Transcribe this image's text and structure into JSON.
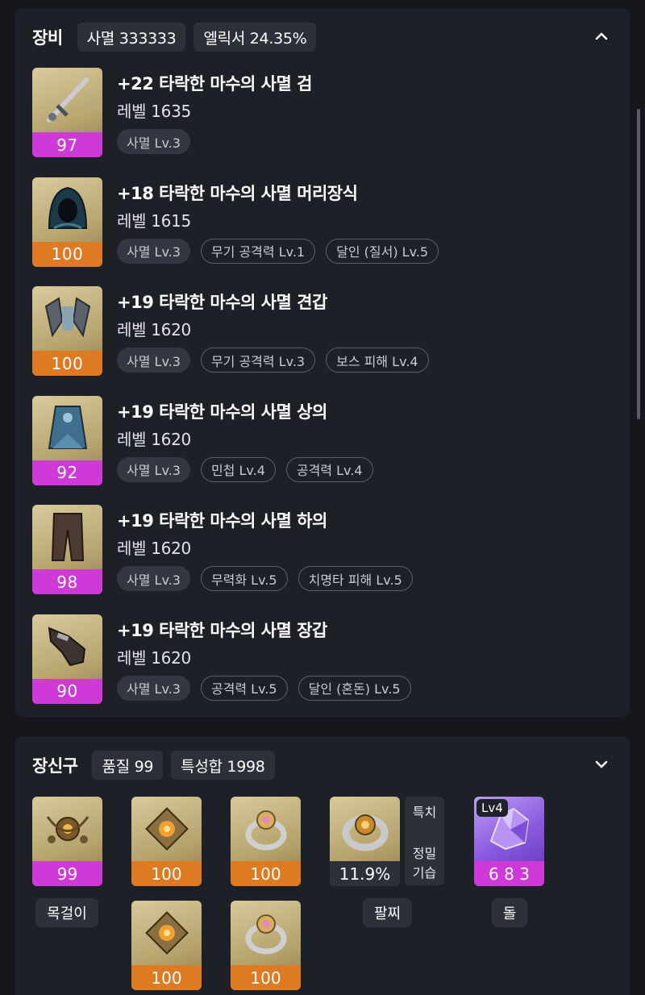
{
  "equipment": {
    "title": "장비",
    "badges": [
      "사멸 333333",
      "엘릭서 24.35%"
    ],
    "items": [
      {
        "name": "+22 타락한 마수의 사멸 검",
        "level": "레벨 1635",
        "quality": "97",
        "quality_color": "#cf39d8",
        "icon": "sword-icon",
        "chips": [
          {
            "text": "사멸 Lv.3",
            "style": "filled"
          }
        ]
      },
      {
        "name": "+18 타락한 마수의 사멸 머리장식",
        "level": "레벨 1615",
        "quality": "100",
        "quality_color": "#dd7a22",
        "icon": "helmet-icon",
        "chips": [
          {
            "text": "사멸 Lv.3",
            "style": "filled"
          },
          {
            "text": "무기 공격력 Lv.1",
            "style": "outline"
          },
          {
            "text": "달인 (질서) Lv.5",
            "style": "outline"
          }
        ]
      },
      {
        "name": "+19 타락한 마수의 사멸 견갑",
        "level": "레벨 1620",
        "quality": "100",
        "quality_color": "#dd7a22",
        "icon": "shoulder-icon",
        "chips": [
          {
            "text": "사멸 Lv.3",
            "style": "filled"
          },
          {
            "text": "무기 공격력 Lv.3",
            "style": "outline"
          },
          {
            "text": "보스 피해 Lv.4",
            "style": "outline"
          }
        ]
      },
      {
        "name": "+19 타락한 마수의 사멸 상의",
        "level": "레벨 1620",
        "quality": "92",
        "quality_color": "#cf39d8",
        "icon": "chest-icon",
        "chips": [
          {
            "text": "사멸 Lv.3",
            "style": "filled"
          },
          {
            "text": "민첩 Lv.4",
            "style": "outline"
          },
          {
            "text": "공격력 Lv.4",
            "style": "outline"
          }
        ]
      },
      {
        "name": "+19 타락한 마수의 사멸 하의",
        "level": "레벨 1620",
        "quality": "98",
        "quality_color": "#cf39d8",
        "icon": "pants-icon",
        "chips": [
          {
            "text": "사멸 Lv.3",
            "style": "filled"
          },
          {
            "text": "무력화 Lv.5",
            "style": "outline"
          },
          {
            "text": "치명타 피해 Lv.5",
            "style": "outline"
          }
        ]
      },
      {
        "name": "+19 타락한 마수의 사멸 장갑",
        "level": "레벨 1620",
        "quality": "90",
        "quality_color": "#cf39d8",
        "icon": "gloves-icon",
        "chips": [
          {
            "text": "사멸 Lv.3",
            "style": "filled"
          },
          {
            "text": "공격력 Lv.5",
            "style": "outline"
          },
          {
            "text": "달인 (혼돈) Lv.5",
            "style": "outline"
          }
        ]
      }
    ]
  },
  "accessories": {
    "title": "장신구",
    "badges": [
      "품질 99",
      "특성합 1998"
    ],
    "necklace": {
      "quality": "99",
      "label": "목걸이"
    },
    "earrings": [
      "100",
      "100"
    ],
    "rings": [
      "100",
      "100"
    ],
    "bracelet": {
      "percent": "11.9%",
      "label": "팔찌",
      "traits": [
        "특치",
        "정밀",
        "기습"
      ]
    },
    "stone": {
      "level": "Lv4",
      "value": "6 8 3",
      "label": "돌"
    }
  }
}
